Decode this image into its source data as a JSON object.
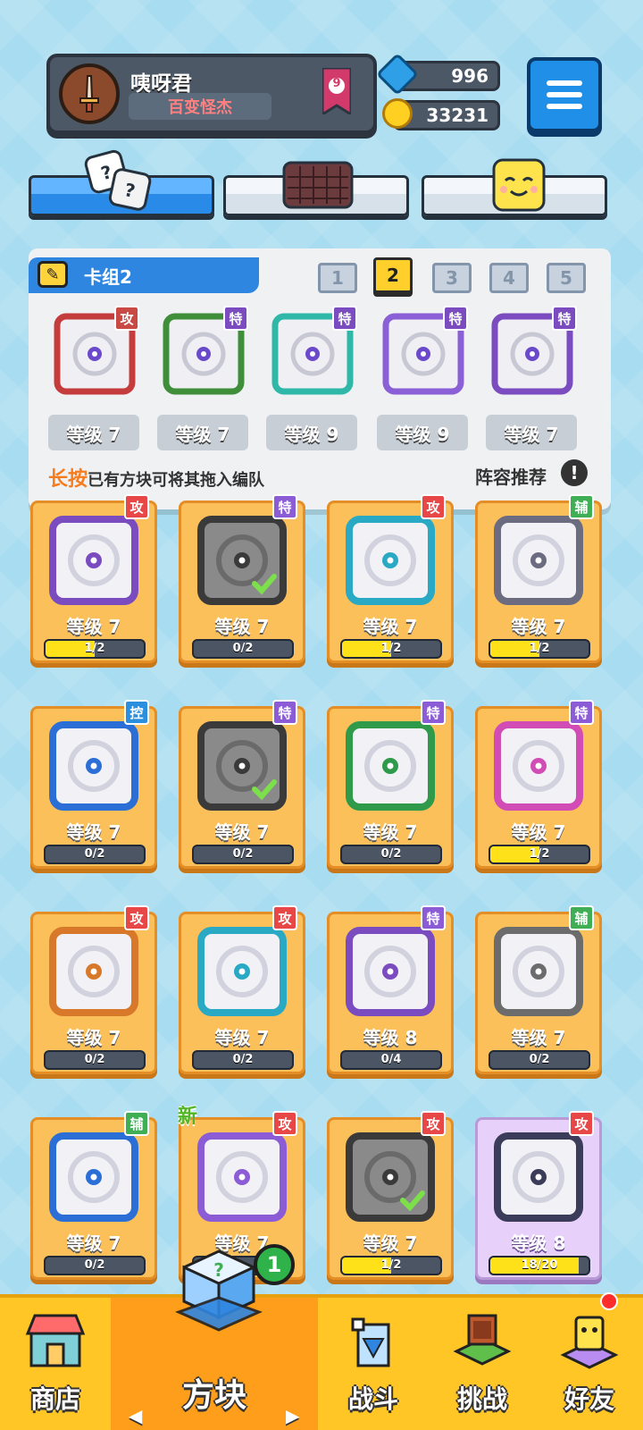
{
  "profile": {
    "name": "咦呀君",
    "title": "百变怪杰",
    "rank": "9"
  },
  "currency": {
    "gems": "996",
    "coins": "33231"
  },
  "deck": {
    "title": "卡组2",
    "numbers": [
      "1",
      "2",
      "3",
      "4",
      "5"
    ],
    "active_number": "2",
    "cards": [
      {
        "tag": "攻",
        "level": "等级 7",
        "color": "#c94a45",
        "frame": "#c43c3c"
      },
      {
        "tag": "特",
        "level": "等级 7",
        "color": "#7a4cc0",
        "frame": "#3f8f3a"
      },
      {
        "tag": "特",
        "level": "等级 9",
        "color": "#7a4cc0",
        "frame": "#2fb8a8"
      },
      {
        "tag": "特",
        "level": "等级 9",
        "color": "#7a4cc0",
        "frame": "#8b5fd6"
      },
      {
        "tag": "特",
        "level": "等级 7",
        "color": "#7a4cc0",
        "frame": "#7a4cc0"
      }
    ],
    "hint_prefix": "长按",
    "hint_rest": "已有方块可将其拖入编队",
    "recommend": "阵容推荐",
    "info": "!"
  },
  "collection": [
    {
      "tag": "攻",
      "tag_color": "#e84747",
      "level": "等级 7",
      "progress": "1/2",
      "fill": 0.5,
      "frame": "#7a4cc0",
      "checked": false,
      "new": false
    },
    {
      "tag": "特",
      "tag_color": "#8b5cd6",
      "level": "等级 7",
      "progress": "0/2",
      "fill": 0,
      "frame": "#3a3a3a",
      "checked": true,
      "new": false
    },
    {
      "tag": "攻",
      "tag_color": "#e84747",
      "level": "等级 7",
      "progress": "1/2",
      "fill": 0.5,
      "frame": "#2aa9c4",
      "checked": false,
      "new": false
    },
    {
      "tag": "辅",
      "tag_color": "#3fae55",
      "level": "等级 7",
      "progress": "1/2",
      "fill": 0.5,
      "frame": "#6c6c80",
      "checked": false,
      "new": false
    },
    {
      "tag": "控",
      "tag_color": "#2b8fe0",
      "level": "等级 7",
      "progress": "0/2",
      "fill": 0,
      "frame": "#2b6fd6",
      "checked": false,
      "new": false
    },
    {
      "tag": "特",
      "tag_color": "#8b5cd6",
      "level": "等级 7",
      "progress": "0/2",
      "fill": 0,
      "frame": "#3a3a3a",
      "checked": true,
      "new": false
    },
    {
      "tag": "特",
      "tag_color": "#8b5cd6",
      "level": "等级 7",
      "progress": "0/2",
      "fill": 0,
      "frame": "#2f9a4a",
      "checked": false,
      "new": false
    },
    {
      "tag": "特",
      "tag_color": "#8b5cd6",
      "level": "等级 7",
      "progress": "1/2",
      "fill": 0.5,
      "frame": "#d14cb5",
      "checked": false,
      "new": false
    },
    {
      "tag": "攻",
      "tag_color": "#e84747",
      "level": "等级 7",
      "progress": "0/2",
      "fill": 0,
      "frame": "#d8782a",
      "checked": false,
      "new": false
    },
    {
      "tag": "攻",
      "tag_color": "#e84747",
      "level": "等级 7",
      "progress": "0/2",
      "fill": 0,
      "frame": "#2aa9c4",
      "checked": false,
      "new": false
    },
    {
      "tag": "特",
      "tag_color": "#8b5cd6",
      "level": "等级 8",
      "progress": "0/4",
      "fill": 0,
      "frame": "#7a4cc0",
      "checked": false,
      "new": false
    },
    {
      "tag": "辅",
      "tag_color": "#3fae55",
      "level": "等级 7",
      "progress": "0/2",
      "fill": 0,
      "frame": "#6c6c6c",
      "checked": false,
      "new": false
    },
    {
      "tag": "辅",
      "tag_color": "#3fae55",
      "level": "等级 7",
      "progress": "0/2",
      "fill": 0,
      "frame": "#2b6fd6",
      "checked": false,
      "new": false
    },
    {
      "tag": "攻",
      "tag_color": "#e84747",
      "level": "等级 7",
      "progress": "",
      "fill": 0,
      "frame": "#8b5cd6",
      "checked": false,
      "new": true,
      "new_label": "新"
    },
    {
      "tag": "攻",
      "tag_color": "#e84747",
      "level": "等级 7",
      "progress": "1/2",
      "fill": 0.5,
      "frame": "#3a3a3a",
      "checked": true,
      "new": false
    },
    {
      "tag": "攻",
      "tag_color": "#e84747",
      "level": "等级 8",
      "progress": "18/20",
      "fill": 0.9,
      "frame": "#3b3b5a",
      "checked": false,
      "new": false,
      "purple": true
    }
  ],
  "nav": {
    "shop": "商店",
    "blocks": "方块",
    "battle": "战斗",
    "challenge": "挑战",
    "friends": "好友",
    "blocks_badge": "1",
    "left_arrow": "◀",
    "right_arrow": "▶"
  }
}
